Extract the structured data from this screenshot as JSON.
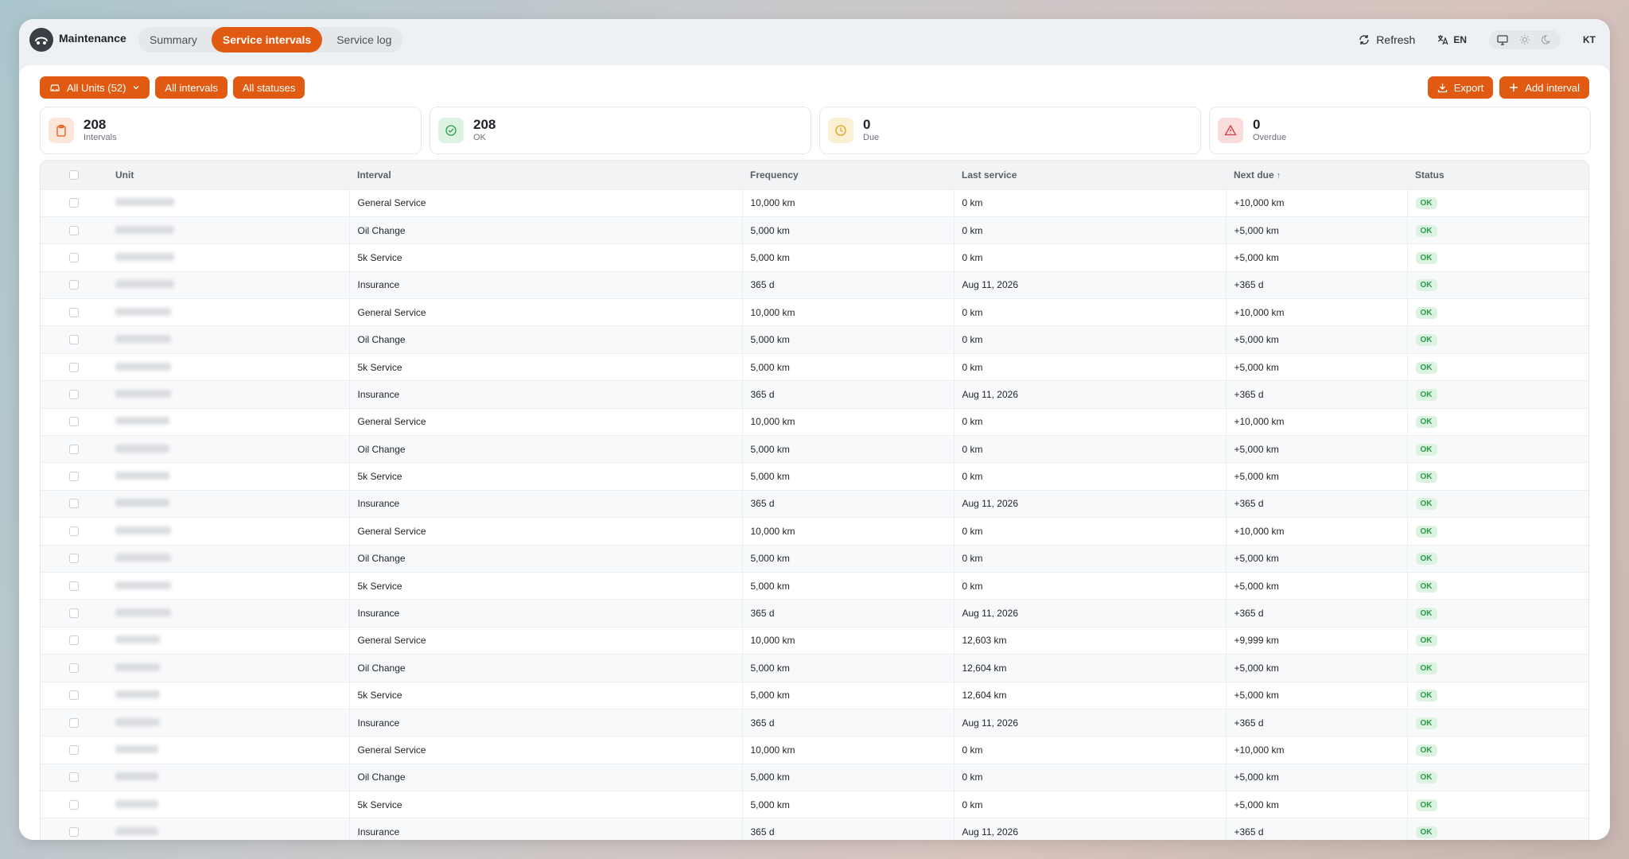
{
  "app": {
    "name": "Maintenance"
  },
  "nav": {
    "tabs": [
      {
        "label": "Summary"
      },
      {
        "label": "Service intervals"
      },
      {
        "label": "Service log"
      }
    ]
  },
  "top": {
    "refresh": "Refresh",
    "lang": "EN",
    "user": "KT"
  },
  "filters": {
    "units": "All Units (52)",
    "intervals": "All intervals",
    "statuses": "All statuses"
  },
  "actions": {
    "export": "Export",
    "add": "Add interval"
  },
  "stats": [
    {
      "value": "208",
      "label": "Intervals",
      "color": "#e15a12"
    },
    {
      "value": "208",
      "label": "OK",
      "color": "#2e9b4a"
    },
    {
      "value": "0",
      "label": "Due",
      "color": "#d9a21b"
    },
    {
      "value": "0",
      "label": "Overdue",
      "color": "#d63b3b"
    }
  ],
  "table": {
    "headers": {
      "unit": "Unit",
      "interval": "Interval",
      "frequency": "Frequency",
      "last": "Last service",
      "next": "Next due",
      "status": "Status"
    },
    "rows": [
      {
        "interval": "General Service",
        "frequency": "10,000 km",
        "last": "0 km",
        "next": "+10,000 km",
        "status": "OK"
      },
      {
        "interval": "Oil Change",
        "frequency": "5,000 km",
        "last": "0 km",
        "next": "+5,000 km",
        "status": "OK"
      },
      {
        "interval": "5k Service",
        "frequency": "5,000 km",
        "last": "0 km",
        "next": "+5,000 km",
        "status": "OK"
      },
      {
        "interval": "Insurance",
        "frequency": "365 d",
        "last": "Aug 11, 2026",
        "next": "+365 d",
        "status": "OK"
      },
      {
        "interval": "General Service",
        "frequency": "10,000 km",
        "last": "0 km",
        "next": "+10,000 km",
        "status": "OK"
      },
      {
        "interval": "Oil Change",
        "frequency": "5,000 km",
        "last": "0 km",
        "next": "+5,000 km",
        "status": "OK"
      },
      {
        "interval": "5k Service",
        "frequency": "5,000 km",
        "last": "0 km",
        "next": "+5,000 km",
        "status": "OK"
      },
      {
        "interval": "Insurance",
        "frequency": "365 d",
        "last": "Aug 11, 2026",
        "next": "+365 d",
        "status": "OK"
      },
      {
        "interval": "General Service",
        "frequency": "10,000 km",
        "last": "0 km",
        "next": "+10,000 km",
        "status": "OK"
      },
      {
        "interval": "Oil Change",
        "frequency": "5,000 km",
        "last": "0 km",
        "next": "+5,000 km",
        "status": "OK"
      },
      {
        "interval": "5k Service",
        "frequency": "5,000 km",
        "last": "0 km",
        "next": "+5,000 km",
        "status": "OK"
      },
      {
        "interval": "Insurance",
        "frequency": "365 d",
        "last": "Aug 11, 2026",
        "next": "+365 d",
        "status": "OK"
      },
      {
        "interval": "General Service",
        "frequency": "10,000 km",
        "last": "0 km",
        "next": "+10,000 km",
        "status": "OK"
      },
      {
        "interval": "Oil Change",
        "frequency": "5,000 km",
        "last": "0 km",
        "next": "+5,000 km",
        "status": "OK"
      },
      {
        "interval": "5k Service",
        "frequency": "5,000 km",
        "last": "0 km",
        "next": "+5,000 km",
        "status": "OK"
      },
      {
        "interval": "Insurance",
        "frequency": "365 d",
        "last": "Aug 11, 2026",
        "next": "+365 d",
        "status": "OK"
      },
      {
        "interval": "General Service",
        "frequency": "10,000 km",
        "last": "12,603 km",
        "next": "+9,999 km",
        "status": "OK"
      },
      {
        "interval": "Oil Change",
        "frequency": "5,000 km",
        "last": "12,604 km",
        "next": "+5,000 km",
        "status": "OK"
      },
      {
        "interval": "5k Service",
        "frequency": "5,000 km",
        "last": "12,604 km",
        "next": "+5,000 km",
        "status": "OK"
      },
      {
        "interval": "Insurance",
        "frequency": "365 d",
        "last": "Aug 11, 2026",
        "next": "+365 d",
        "status": "OK"
      },
      {
        "interval": "General Service",
        "frequency": "10,000 km",
        "last": "0 km",
        "next": "+10,000 km",
        "status": "OK"
      },
      {
        "interval": "Oil Change",
        "frequency": "5,000 km",
        "last": "0 km",
        "next": "+5,000 km",
        "status": "OK"
      },
      {
        "interval": "5k Service",
        "frequency": "5,000 km",
        "last": "0 km",
        "next": "+5,000 km",
        "status": "OK"
      },
      {
        "interval": "Insurance",
        "frequency": "365 d",
        "last": "Aug 11, 2026",
        "next": "+365 d",
        "status": "OK"
      }
    ]
  }
}
